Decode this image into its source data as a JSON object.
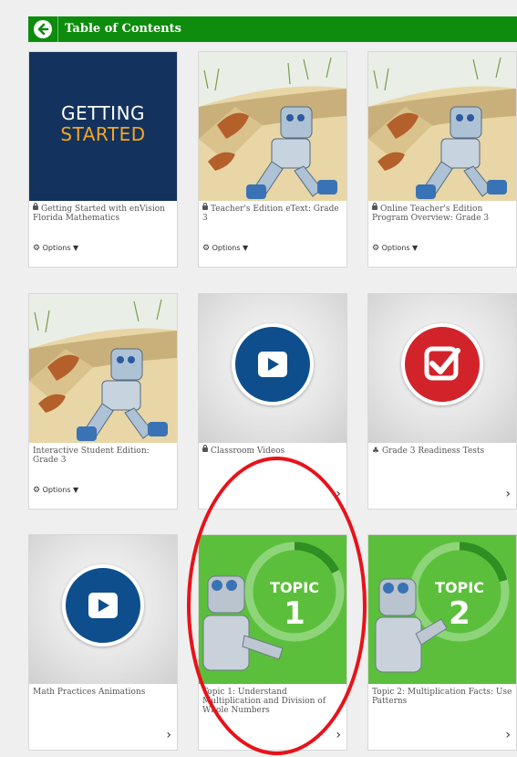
{
  "header": {
    "title": "Table of Contents",
    "back_icon": "arrow-left-icon"
  },
  "options_label": "Options",
  "cards": [
    {
      "caption": "Getting Started with enVision Florida Mathematics",
      "locked": true,
      "thumb": "getting-started",
      "thumb_line1": "GETTING",
      "thumb_line2": "STARTED",
      "action": "options"
    },
    {
      "caption": "Teacher's Edition eText: Grade 3",
      "locked": true,
      "thumb": "robot-illustration",
      "action": "options"
    },
    {
      "caption": "Online Teacher's Edition Program Overview: Grade 3",
      "locked": true,
      "thumb": "robot-illustration",
      "action": "options"
    },
    {
      "caption": "Interactive Student Edition: Grade 3",
      "locked": false,
      "thumb": "robot-illustration",
      "action": "options"
    },
    {
      "caption": "Classroom Videos",
      "locked": true,
      "thumb": "video-play",
      "action": "chevron"
    },
    {
      "caption": "Grade 3 Readiness Tests",
      "locked": false,
      "icon": "assessment-icon",
      "thumb": "checkmark",
      "action": "chevron"
    },
    {
      "caption": "Math Practices Animations",
      "locked": false,
      "thumb": "video-play",
      "action": "chevron"
    },
    {
      "caption": "Topic 1: Understand Multiplication and Division of Whole Numbers",
      "locked": false,
      "thumb": "topic",
      "topic_word": "TOPIC",
      "topic_number": "1",
      "action": "chevron"
    },
    {
      "caption": "Topic 2: Multiplication Facts: Use Patterns",
      "locked": false,
      "thumb": "topic",
      "topic_word": "TOPIC",
      "topic_number": "2",
      "action": "chevron"
    }
  ],
  "colors": {
    "header_green": "#0d8c0d",
    "annotation_red": "#e8121a",
    "play_blue": "#0e4e8c",
    "check_red": "#d2232a",
    "topic_green": "#5bbf3c"
  }
}
